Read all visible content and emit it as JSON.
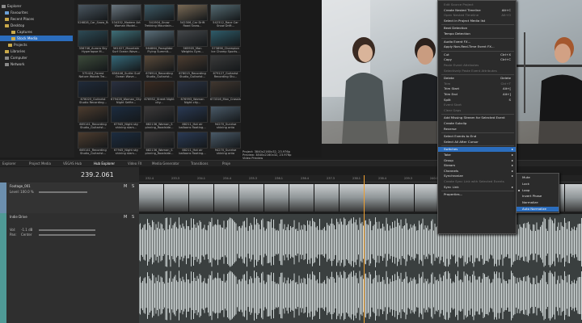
{
  "explorer": {
    "items": [
      {
        "label": "Explorer",
        "icon": "computer-icon"
      },
      {
        "label": "Favourites",
        "icon": "star-icon"
      },
      {
        "label": "Recent Places",
        "icon": "folder-icon"
      },
      {
        "label": "Desktop",
        "icon": "folder-icon"
      },
      {
        "label": "Captures",
        "icon": "folder-icon"
      },
      {
        "label": "Stock Media",
        "icon": "folder-icon"
      },
      {
        "label": "Projects",
        "icon": "folder-icon"
      },
      {
        "label": "Libraries",
        "icon": "folder-icon"
      },
      {
        "label": "Computer",
        "icon": "computer-icon"
      },
      {
        "label": "Network",
        "icon": "network-icon"
      }
    ]
  },
  "thumbs": [
    {
      "cap": "526828_Car_Snow_Road_Infield_B..."
    },
    {
      "cap": "534332_Modern Art Woman Model..."
    },
    {
      "cap": "541904_Snow Trekking Mountain..."
    },
    {
      "cap": "542306_Car Drift Road Snow..."
    },
    {
      "cap": "542312_Race Car Snow Drift..."
    },
    {
      "cap": "356746_Aurora Sky Hyperlapse M..."
    },
    {
      "cap": "561027_Mountain Surf Ocean Wave..."
    },
    {
      "cap": "564864_Paraglider Flying Summit..."
    },
    {
      "cap": "565905_Man Weights Gym..."
    },
    {
      "cap": "573896_Champion Ice Champ Sports..."
    },
    {
      "cap": "575424_Forest Nature Woods Tre..."
    },
    {
      "cap": "656446_Surfer Surf Ocean Wave..."
    },
    {
      "cap": "676914_Recording Studio_Guitarist..."
    },
    {
      "cap": "678015_Recording Studio_Guitarist..."
    },
    {
      "cap": "679127_Guitarist Recording Stu..."
    },
    {
      "cap": "678025_Guitarist Studio Recording..."
    },
    {
      "cap": "679428_Woman_City Night Selfie..."
    },
    {
      "cap": "676952_Street Night city..."
    },
    {
      "cap": "676993_Woman Night city..."
    },
    {
      "cap": "673316_Man_Crossing_Stree..."
    },
    {
      "cap": "685141_Recording Studio_Guitarist..."
    },
    {
      "cap": "67945_Night sky shining stars..."
    },
    {
      "cap": "682136_Woman_S pinning_Roadside..."
    },
    {
      "cap": "88211_Hot air balloons floating..."
    },
    {
      "cap": "94270_Sunrise shining onto meado..."
    },
    {
      "cap": "685141_Recording Studio_Guitarist..."
    },
    {
      "cap": "67945_Night sky shining stars..."
    },
    {
      "cap": "682136_Woman_S pinning_Roadside..."
    },
    {
      "cap": "88211_Hot air balloons floating..."
    },
    {
      "cap": "94270_Sunrise shining onto meado..."
    }
  ],
  "mid": {
    "project": "Project: 3840x2160x32, 23.976p",
    "preview": "Preview: 3840x2160x32, 23.976p",
    "video_fx": "Video Preview"
  },
  "tabs": [
    "Explorer",
    "Project Media",
    "VEGAS Hub",
    "Hub Explorer",
    "Video FX",
    "Media Generator",
    "Transitions",
    "Proje"
  ],
  "timeline": {
    "timecode": "239.2.061",
    "track1": {
      "name": "Footage_001",
      "level": "Level: 100.0 %",
      "m": "M",
      "s": "S"
    },
    "track2": {
      "name": "Indie Drive",
      "m": "M",
      "s": "S",
      "vol": "Vol:",
      "vol_value": "-1.1 dB",
      "pan": "Pan:",
      "pan_value": "Center"
    },
    "ruler": [
      "232.4",
      "233.3",
      "234.1",
      "234.4",
      "235.3",
      "236.1",
      "236.4",
      "237.3",
      "238.1",
      "238.4",
      "239.3",
      "240.1",
      "240.4",
      "241.3",
      "242.1"
    ]
  },
  "context_menu": {
    "items": [
      {
        "label": "Edit Source Project",
        "disabled": true
      },
      {
        "label": "Create Nested Timeline",
        "shortcut": "Alt+C"
      },
      {
        "label": "Open Nested Timeline",
        "shortcut": "Alt+O",
        "disabled": true
      },
      {
        "label": "Select in Project Media list"
      },
      {
        "sep": true
      },
      {
        "label": "Beat Detection"
      },
      {
        "label": "Tempo Detection"
      },
      {
        "sep": true
      },
      {
        "label": "Audio Event FX..."
      },
      {
        "label": "Apply Non-Real-Time Event FX..."
      },
      {
        "sep": true
      },
      {
        "label": "Cut",
        "shortcut": "Ctrl+X"
      },
      {
        "label": "Copy",
        "shortcut": "Ctrl+C"
      },
      {
        "label": "Paste Event Attributes",
        "disabled": true
      },
      {
        "label": "Selectively Paste Event Attributes",
        "disabled": true
      },
      {
        "sep": true
      },
      {
        "label": "Delete",
        "shortcut": "Delete"
      },
      {
        "label": "Trim",
        "shortcut": "Ctrl+T",
        "disabled": true
      },
      {
        "label": "Trim Start",
        "shortcut": "Alt+["
      },
      {
        "label": "Trim End",
        "shortcut": "Alt+]"
      },
      {
        "label": "Split",
        "shortcut": "S"
      },
      {
        "label": "Event Start",
        "disabled": true
      },
      {
        "label": "Clear Gaps",
        "disabled": true
      },
      {
        "sep": true
      },
      {
        "label": "Add Missing Stream for Selected Event"
      },
      {
        "label": "Create Subclip"
      },
      {
        "label": "Reverse"
      },
      {
        "sep": true
      },
      {
        "label": "Select Events to End"
      },
      {
        "label": "Select All After Cursor"
      },
      {
        "sep": true
      },
      {
        "label": "Switches",
        "arrow": true,
        "highlight": true
      },
      {
        "label": "Take",
        "arrow": true
      },
      {
        "label": "Group",
        "arrow": true
      },
      {
        "label": "Stream",
        "arrow": true
      },
      {
        "label": "Channels",
        "arrow": true
      },
      {
        "label": "Synchronize",
        "arrow": true
      },
      {
        "label": "Create Sync Link with Selected Events",
        "disabled": true
      },
      {
        "label": "Sync Link",
        "arrow": true
      },
      {
        "sep": true
      },
      {
        "label": "Properties..."
      }
    ]
  },
  "submenu": {
    "items": [
      {
        "label": "Mute"
      },
      {
        "label": "Lock"
      },
      {
        "label": "Loop",
        "checked": true
      },
      {
        "label": "Invert Phase"
      },
      {
        "label": "Normalize"
      },
      {
        "label": "Auto Normalize",
        "highlight": true
      }
    ]
  }
}
